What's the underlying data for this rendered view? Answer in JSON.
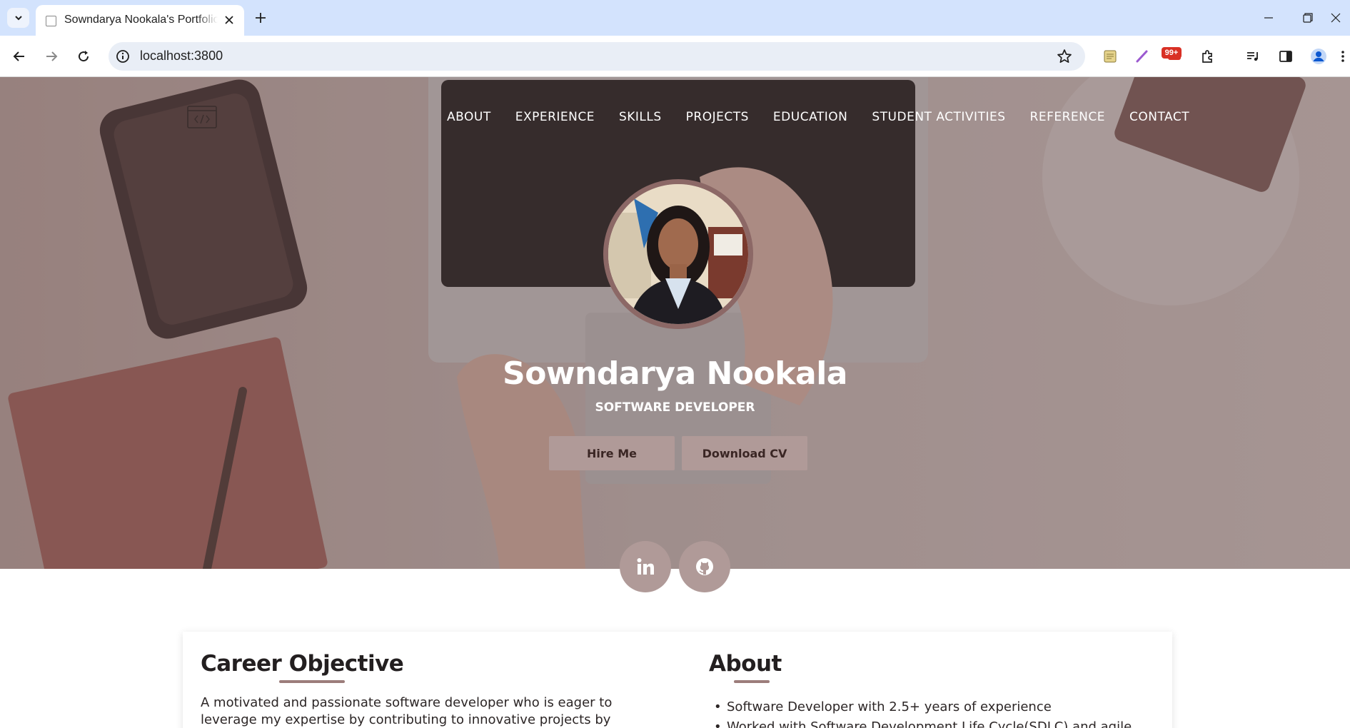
{
  "browser": {
    "tab_title": "Sowndarya Nookala's Portfolio",
    "url": "localhost:3800",
    "extension_badge": "99+"
  },
  "hero": {
    "nav": [
      "ABOUT",
      "EXPERIENCE",
      "SKILLS",
      "PROJECTS",
      "EDUCATION",
      "STUDENT ACTIVITIES",
      "REFERENCE",
      "CONTACT"
    ],
    "name": "Sowndarya Nookala",
    "role": "SOFTWARE DEVELOPER",
    "hire_label": "Hire Me",
    "cv_label": "Download CV",
    "social": [
      "linkedin",
      "github"
    ],
    "accent_color": "#b09a98"
  },
  "career": {
    "title": "Career Objective",
    "lines": [
      "A motivated and passionate software developer who is eager to",
      "leverage my expertise by contributing to innovative projects by"
    ]
  },
  "about": {
    "title": "About",
    "items": [
      "Software Developer with 2.5+ years of experience",
      "Worked with Software Development Life Cycle(SDLC) and agile"
    ]
  }
}
